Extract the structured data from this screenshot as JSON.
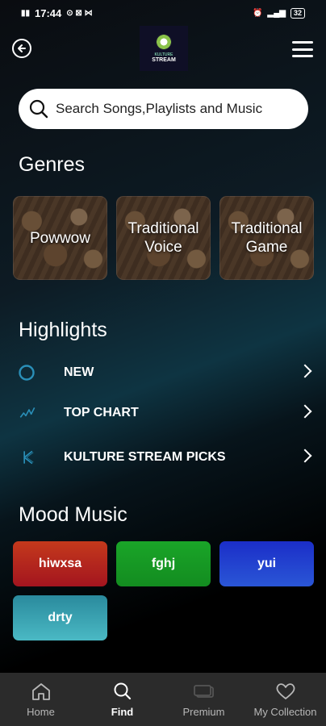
{
  "status_bar": {
    "time": "17:44",
    "battery": "32"
  },
  "header": {
    "logo_small": "KULTURE",
    "logo_text": "STREAM"
  },
  "search": {
    "placeholder": "Search Songs,Playlists and Music"
  },
  "genres": {
    "title": "Genres",
    "items": [
      {
        "label": "Powwow"
      },
      {
        "label": "Traditional Voice"
      },
      {
        "label": "Traditional Game"
      }
    ]
  },
  "highlights": {
    "title": "Highlights",
    "items": [
      {
        "label": "NEW",
        "icon": "circle-icon"
      },
      {
        "label": "TOP CHART",
        "icon": "chart-trend-icon"
      },
      {
        "label": "KULTURE STREAM PICKS",
        "icon": "kulture-logo-icon"
      }
    ]
  },
  "mood": {
    "title": "Mood Music",
    "items": [
      {
        "label": "hiwxsa",
        "color": "#b22222"
      },
      {
        "label": "fghj",
        "color": "#1aa02a"
      },
      {
        "label": "yui",
        "color": "#1f3fc9"
      },
      {
        "label": "drty",
        "color": "#3aa3b5"
      }
    ]
  },
  "bottom_nav": {
    "items": [
      {
        "label": "Home",
        "icon": "home-icon"
      },
      {
        "label": "Find",
        "icon": "search-icon"
      },
      {
        "label": "Premium",
        "icon": "premium-icon"
      },
      {
        "label": "My Collection",
        "icon": "heart-icon"
      }
    ],
    "active": "Find"
  },
  "colors": {
    "accent": "#2a8fb8",
    "nav_bg": "#2b2b2b"
  }
}
